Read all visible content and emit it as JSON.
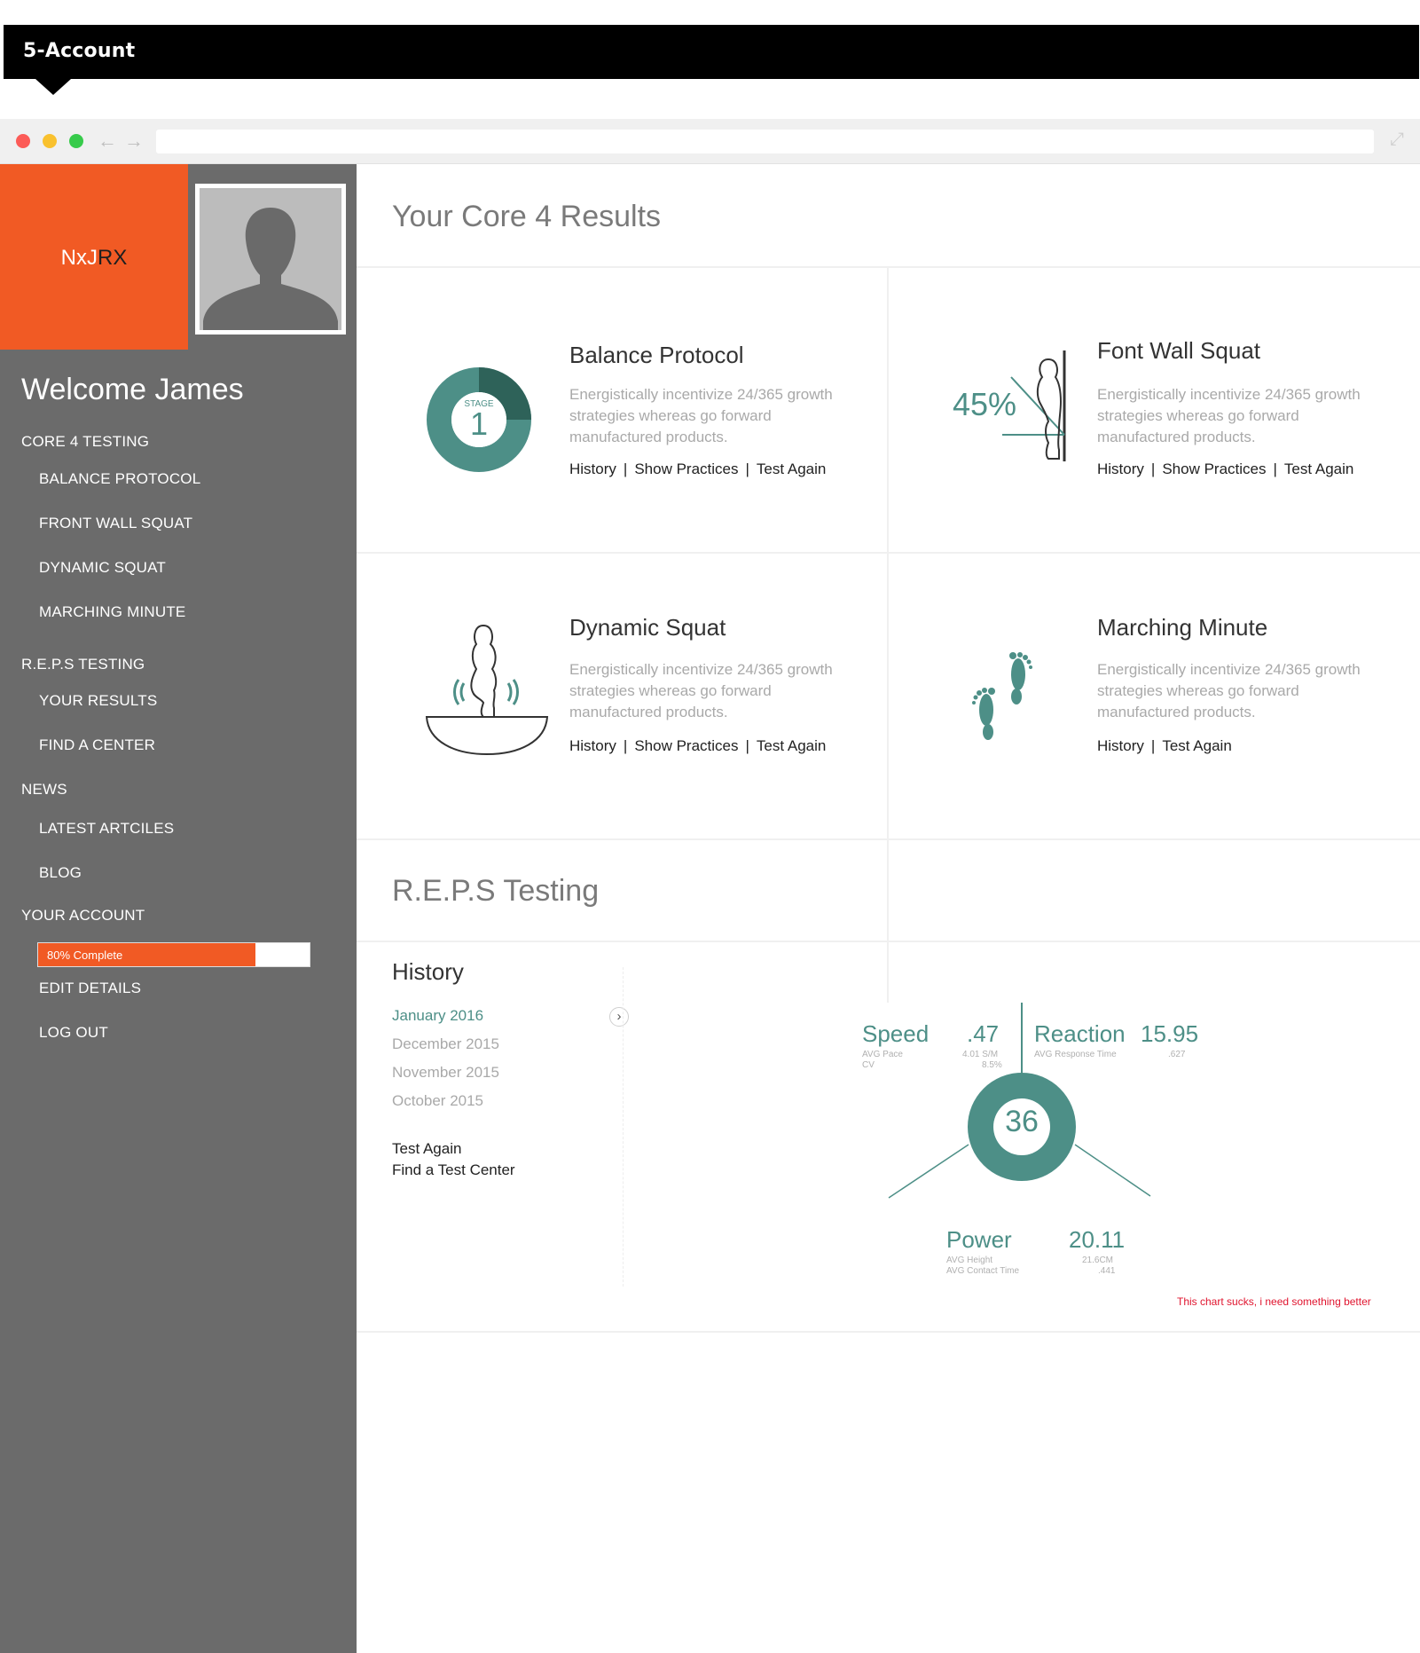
{
  "header": {
    "title": "5-Account"
  },
  "browser": {
    "back_icon": "arrow-left-icon",
    "forward_icon": "arrow-right-icon",
    "expand_icon": "expand-icon"
  },
  "brand": {
    "part1": "NxJ",
    "part2": "RX"
  },
  "sidebar": {
    "welcome": "Welcome James",
    "sections": [
      {
        "label": "CORE 4 TESTING",
        "items": [
          "BALANCE PROTOCOL",
          "FRONT WALL SQUAT",
          "DYNAMIC SQUAT",
          "MARCHING MINUTE"
        ]
      },
      {
        "label": "R.E.P.S TESTING",
        "items": [
          "YOUR RESULTS",
          "FIND A CENTER"
        ]
      },
      {
        "label": "NEWS",
        "items": [
          "LATEST ARTCILES",
          "BLOG"
        ]
      },
      {
        "label": "YOUR ACCOUNT",
        "items": [
          "EDIT DETAILS",
          "LOG OUT"
        ]
      }
    ],
    "progress": {
      "label": "80% Complete",
      "value": 0.8,
      "color": "#f15a24"
    }
  },
  "core": {
    "title": "Your Core 4 Results",
    "cards": [
      {
        "title": "Balance Protocol",
        "desc": "Energistically incentivize 24/365 growth strategies whereas go forward manufactured products.",
        "links": [
          "History",
          "Show Practices",
          "Test Again"
        ],
        "stage_label": "STAGE",
        "stage_value": "1"
      },
      {
        "title": "Font Wall Squat",
        "desc": "Energistically incentivize 24/365 growth strategies whereas go forward manufactured products.",
        "links": [
          "History",
          "Show Practices",
          "Test Again"
        ],
        "percent": "45%"
      },
      {
        "title": "Dynamic Squat",
        "desc": "Energistically incentivize 24/365 growth strategies whereas go forward manufactured products.",
        "links": [
          "History",
          "Show Practices",
          "Test Again"
        ]
      },
      {
        "title": "Marching Minute",
        "desc": "Energistically incentivize 24/365 growth strategies whereas go forward manufactured products.",
        "links": [
          "History",
          "Test Again"
        ]
      }
    ]
  },
  "reps": {
    "title": "R.E.P.S Testing",
    "history_title": "History",
    "months": [
      "January 2016",
      "December 2015",
      "November 2015",
      "October 2015"
    ],
    "links": [
      "Test Again",
      "Find a Test Center"
    ],
    "center_value": "36",
    "speed": {
      "label": "Speed",
      "value": ".47",
      "sub1": "AVG Pace",
      "sub2": "CV",
      "sub_val1": "4.01 S/M",
      "sub_val2": "8.5%"
    },
    "reaction": {
      "label": "Reaction",
      "value": "15.95",
      "sub1": "AVG Response Time",
      "sub_val1": ".627"
    },
    "power": {
      "label": "Power",
      "value": "20.11",
      "sub1": "AVG Height",
      "sub2": "AVG Contact Time",
      "sub_val1": "21.6CM",
      "sub_val2": ".441"
    },
    "note": "This chart sucks, i need something better"
  },
  "colors": {
    "accent": "#f15a24",
    "teal": "#4d8f87",
    "teal_dark": "#2e6259",
    "sidebar": "#6b6b6b"
  }
}
